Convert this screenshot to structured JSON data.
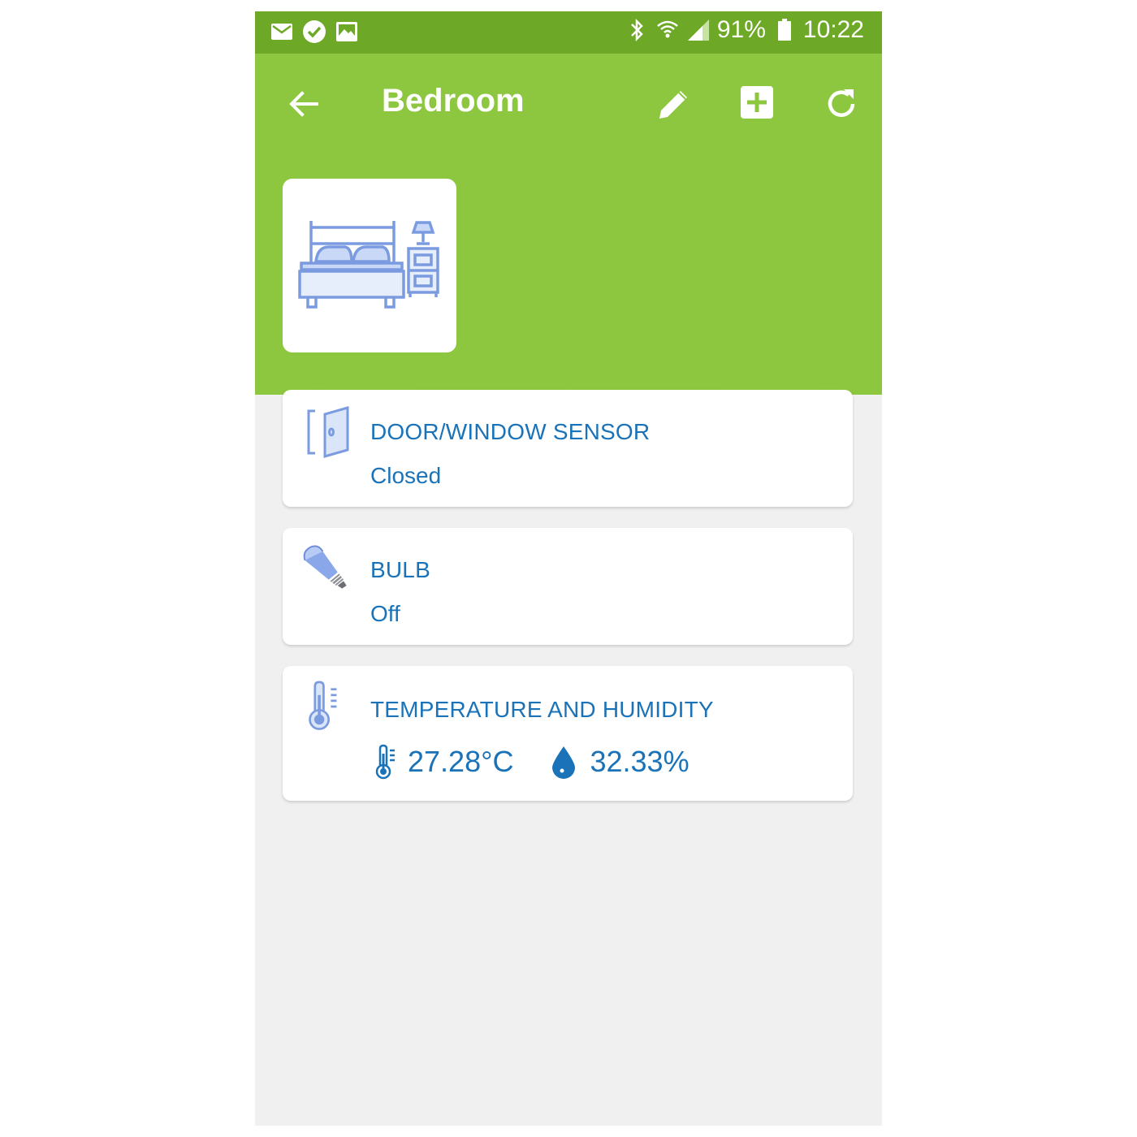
{
  "statusbar": {
    "battery": "91%",
    "time": "10:22",
    "left_icons": [
      "mail-icon",
      "check-circle-icon",
      "image-icon"
    ],
    "right_icons": [
      "bluetooth-icon",
      "wifi-icon",
      "signal-icon",
      "battery-icon"
    ]
  },
  "header": {
    "title": "Bedroom",
    "color": "#8dc63f",
    "actions": [
      "edit-icon",
      "add-icon",
      "refresh-icon"
    ]
  },
  "room": {
    "icon": "bedroom-icon"
  },
  "devices": [
    {
      "title": "DOOR/WINDOW SENSOR",
      "value": "Closed",
      "icon": "door-icon"
    },
    {
      "title": "BULB",
      "value": "Off",
      "icon": "bulb-icon"
    },
    {
      "title": "TEMPERATURE AND HUMIDITY",
      "temperature": "27.28°C",
      "humidity": "32.33%",
      "icon": "thermometer-icon"
    }
  ],
  "colors": {
    "accent_text": "#1a73b8",
    "icon_blue": "#7b9be0",
    "statusbar": "#6da826"
  }
}
